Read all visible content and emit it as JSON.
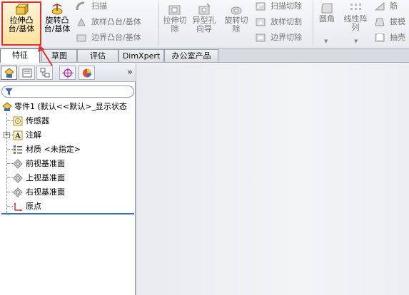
{
  "ribbon": {
    "extrude_boss": {
      "line1": "拉伸凸",
      "line2": "台/基体"
    },
    "revolve_boss": {
      "line1": "旋转凸",
      "line2": "台/基体"
    },
    "swept_boss": "扫描",
    "loft_boss": "放样凸台/基体",
    "boundary_boss": "边界凸台/基体",
    "extrude_cut": {
      "line1": "拉伸切",
      "line2": "除"
    },
    "hole_wizard": {
      "line1": "异型孔",
      "line2": "向导"
    },
    "revolve_cut": {
      "line1": "旋转切",
      "line2": "除"
    },
    "swept_cut": "扫描切除",
    "loft_cut": "放样切割",
    "boundary_cut": "边界切除",
    "fillet": "圆角",
    "linear_pattern": {
      "line1": "线性阵",
      "line2": "列"
    },
    "rib": "筋",
    "draft": "拔模",
    "shell": "抽壳"
  },
  "tabs": [
    "特征",
    "草图",
    "评估",
    "DimXpert",
    "办公室产品"
  ],
  "panel": {
    "more": "»",
    "tree": {
      "part": "零件1 (默认<<默认>_显示状态",
      "sensors": "传感器",
      "annotations": "注解",
      "material": "材质 <未指定>",
      "front_plane": "前视基准面",
      "top_plane": "上视基准面",
      "right_plane": "右视基准面",
      "origin": "原点"
    }
  },
  "colors": {
    "highlight_border": "#e03030",
    "panel_accent": "#3a6fb8"
  }
}
